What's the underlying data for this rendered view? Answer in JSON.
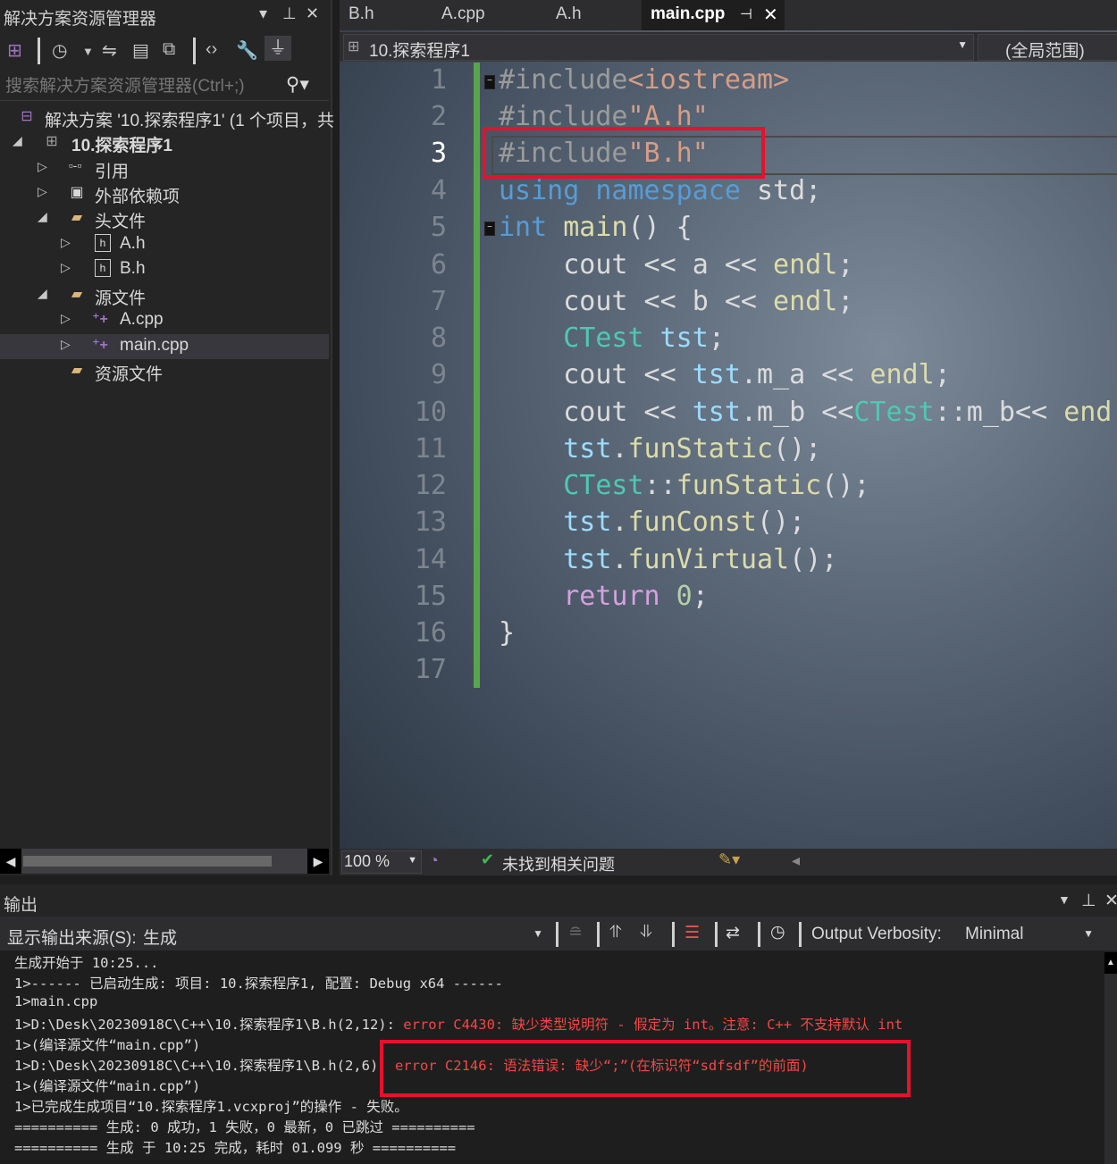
{
  "solution_explorer": {
    "title": "解决方案资源管理器",
    "title_controls": [
      "▾",
      "⊥",
      "✕"
    ],
    "search_placeholder": "搜索解决方案资源管理器(Ctrl+;)",
    "tree": {
      "solution": "解决方案 '10.探索程序1' (1 个项目，共",
      "project": "10.探索程序1",
      "references": "引用",
      "external_deps": "外部依赖项",
      "header_files": "头文件",
      "a_h": "A.h",
      "b_h": "B.h",
      "source_files": "源文件",
      "a_cpp": "A.cpp",
      "main_cpp": "main.cpp",
      "resource_files": "资源文件"
    }
  },
  "editor": {
    "tabs": [
      {
        "label": "B.h"
      },
      {
        "label": "A.cpp"
      },
      {
        "label": "A.h"
      },
      {
        "label": "main.cpp"
      }
    ],
    "nav_project": "10.探索程序1",
    "nav_scope": "(全局范围)",
    "line_numbers": [
      "1",
      "2",
      "3",
      "4",
      "5",
      "6",
      "7",
      "8",
      "9",
      "10",
      "11",
      "12",
      "13",
      "14",
      "15",
      "16",
      "17"
    ],
    "current_line": "3",
    "code": {
      "l1_pre": "#include",
      "l1_str": "<iostream>",
      "l2_pre": "#include",
      "l2_str": "\"A.h\"",
      "l3_pre": "#include",
      "l3_str": "\"B.h\"",
      "l4_using": "using",
      "l4_namespace": "namespace",
      "l4_rest": " std;",
      "l5_int": "int",
      "l5_main": " main",
      "l5_rest": "() {",
      "l6": "    cout << a << ",
      "l6_endl": "endl",
      "l7": "    cout << b << ",
      "l7_endl": "endl",
      "l8_type": "CTest",
      "l8_var": " tst",
      "l9_a": "    cout << ",
      "l9_var": "tst",
      "l9_b": ".m_a << ",
      "l9_endl": "endl",
      "l10_a": "    cout << ",
      "l10_var": "tst",
      "l10_b": ".m_b <<",
      "l10_type": "CTest",
      "l10_c": "::m_b<< ",
      "l10_endl": "end",
      "l11_var": "tst",
      "l11_fn": "funStatic",
      "l12_type": "CTest",
      "l12_fn": "funStatic",
      "l13_var": "tst",
      "l13_fn": "funConst",
      "l14_var": "tst",
      "l14_fn": "funVirtual",
      "l15_ret": "return",
      "l15_num": " 0",
      "l16": "}"
    },
    "status": {
      "zoom": "100 %",
      "issues": "未找到相关问题"
    }
  },
  "output": {
    "title": "输出",
    "source_label": "显示输出来源(S):",
    "source_value": "生成",
    "verbosity_label": "Output Verbosity:",
    "verbosity_value": "Minimal",
    "lines": {
      "l1": "生成开始于 10:25...",
      "l2": "1>------ 已启动生成: 项目: 10.探索程序1, 配置: Debug x64 ------",
      "l3": "1>main.cpp",
      "l4_pre": "1>D:\\Desk\\20230918C\\C++\\10.探索程序1\\B.h(2,12): ",
      "l4_err": "error C4430: 缺少类型说明符 - 假定为 int。注意: C++ 不支持默认 int",
      "l5": "1>(编译源文件“main.cpp”)",
      "l6_pre": "1>D:\\Desk\\20230918C\\C++\\10.探索程序1\\B.h(2,6)",
      "l6_err": ": error C2146: 语法错误: 缺少“;”(在标识符“sdfsdf”的前面)",
      "l7": "1>(编译源文件“main.cpp”)",
      "l8": "1>已完成生成项目“10.探索程序1.vcxproj”的操作 - 失败。",
      "l9": "========== 生成: 0 成功，1 失败，0 最新，0 已跳过 ==========",
      "l10": "========== 生成 于 10:25 完成，耗时 01.099 秒 =========="
    }
  }
}
